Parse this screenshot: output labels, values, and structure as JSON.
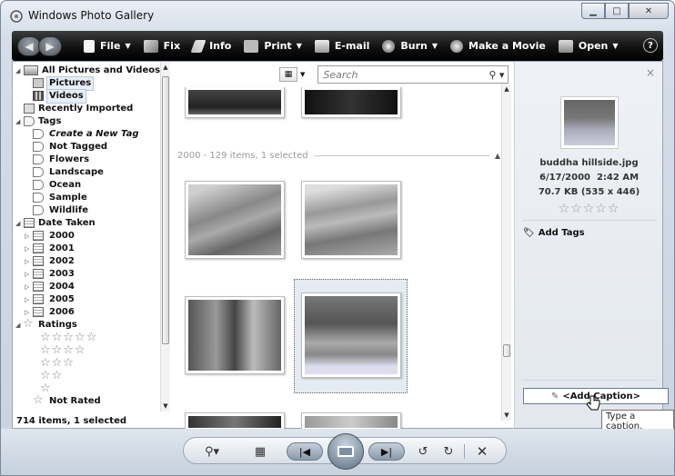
{
  "window": {
    "title": "Windows Photo Gallery"
  },
  "toolbar": {
    "items": [
      {
        "label": "File",
        "icon": "file-icon",
        "dropdown": true
      },
      {
        "label": "Fix",
        "icon": "fix-icon",
        "dropdown": false
      },
      {
        "label": "Info",
        "icon": "info-icon",
        "dropdown": false
      },
      {
        "label": "Print",
        "icon": "print-icon",
        "dropdown": true
      },
      {
        "label": "E-mail",
        "icon": "email-icon",
        "dropdown": false
      },
      {
        "label": "Burn",
        "icon": "burn-icon",
        "dropdown": true
      },
      {
        "label": "Make a Movie",
        "icon": "movie-icon",
        "dropdown": false
      },
      {
        "label": "Open",
        "icon": "open-icon",
        "dropdown": true
      }
    ],
    "help": "?"
  },
  "tree": {
    "items": [
      {
        "label": "All Pictures and Videos",
        "level": 0,
        "expander": "expanded",
        "selected": false
      },
      {
        "label": "Pictures",
        "level": 1,
        "selected": true
      },
      {
        "label": "Videos",
        "level": 1,
        "selected": true
      },
      {
        "label": "Recently Imported",
        "level": 0
      },
      {
        "label": "Tags",
        "level": 0,
        "expander": "expanded"
      },
      {
        "label": "Create a New Tag",
        "level": 1,
        "italic": true
      },
      {
        "label": "Not Tagged",
        "level": 1
      },
      {
        "label": "Flowers",
        "level": 1
      },
      {
        "label": "Landscape",
        "level": 1
      },
      {
        "label": "Ocean",
        "level": 1
      },
      {
        "label": "Sample",
        "level": 1
      },
      {
        "label": "Wildlife",
        "level": 1
      },
      {
        "label": "Date Taken",
        "level": 0,
        "expander": "expanded"
      },
      {
        "label": "2000",
        "level": 1,
        "expander": "collapsed"
      },
      {
        "label": "2001",
        "level": 1,
        "expander": "collapsed"
      },
      {
        "label": "2002",
        "level": 1,
        "expander": "collapsed"
      },
      {
        "label": "2003",
        "level": 1,
        "expander": "collapsed"
      },
      {
        "label": "2004",
        "level": 1,
        "expander": "collapsed"
      },
      {
        "label": "2005",
        "level": 1,
        "expander": "collapsed"
      },
      {
        "label": "2006",
        "level": 1,
        "expander": "collapsed"
      },
      {
        "label": "Ratings",
        "level": 0,
        "expander": "expanded"
      }
    ],
    "ratings": [
      5,
      4,
      3,
      2,
      1
    ],
    "not_rated": "Not Rated",
    "status": "714 items, 1 selected"
  },
  "gallery": {
    "search_placeholder": "Search",
    "group_header": "2000 - 129 items, 1 selected"
  },
  "info_pane": {
    "filename": "buddha hillside.jpg",
    "date": "6/17/2000",
    "time": "2:42 AM",
    "size": "70.7 KB (535 x 446)",
    "rating": 0,
    "add_tags": "Add Tags",
    "add_caption": "<Add Caption>",
    "close": "×"
  },
  "tooltip": "Type a caption.",
  "colors": {
    "toolbar": "#1a1a1a",
    "selection": "#e6eef8",
    "window_frame": "#c9d4e0"
  }
}
